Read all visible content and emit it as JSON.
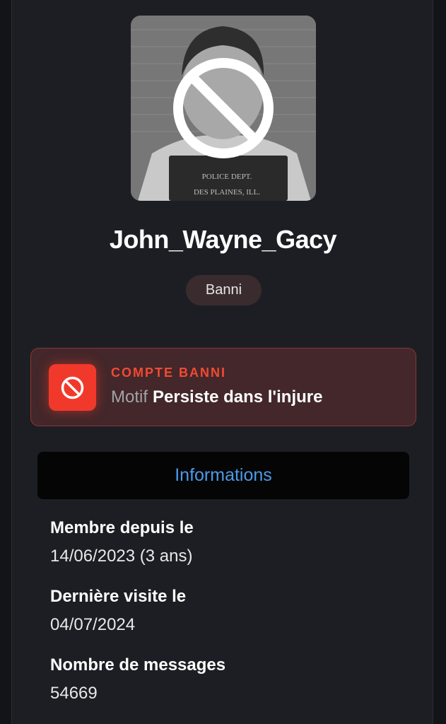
{
  "profile": {
    "username": "John_Wayne_Gacy",
    "status_badge": "Banni",
    "avatar": {
      "icon": "banned-overlay-icon",
      "sign_line1": "POLICE DEPT.",
      "sign_line2": "DES PLAINES, ILL."
    }
  },
  "ban": {
    "title": "COMPTE BANNI",
    "reason_label": "Motif",
    "reason_value": "Persiste dans l'injure",
    "icon": "ban-icon",
    "accent_color": "#f1392b"
  },
  "info": {
    "header": "Informations",
    "items": [
      {
        "label": "Membre depuis le",
        "value": "14/06/2023 (3 ans)"
      },
      {
        "label": "Dernière visite le",
        "value": "04/07/2024"
      },
      {
        "label": "Nombre de messages",
        "value": "54669"
      }
    ]
  }
}
